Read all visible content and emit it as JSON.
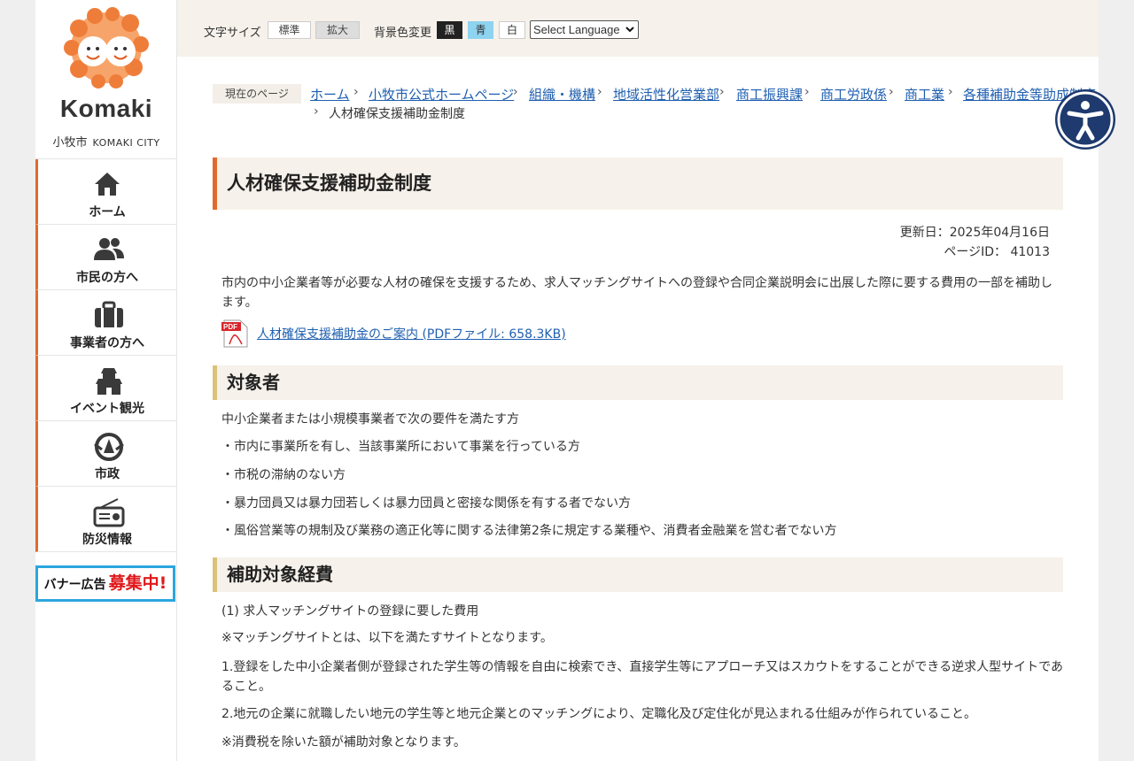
{
  "sidebar": {
    "logo_word": "Komaki",
    "city_name": "小牧市",
    "city_name_en": "KOMAKI CITY",
    "logo_icon": "komaki-faces-logo",
    "nav": [
      {
        "label": "ホーム",
        "icon": "home-icon"
      },
      {
        "label": "市民の方へ",
        "icon": "citizens-icon"
      },
      {
        "label": "事業者の方へ",
        "icon": "briefcase-icon"
      },
      {
        "label": "イベント観光",
        "icon": "castle-icon"
      },
      {
        "label": "市政",
        "icon": "city-emblem-icon"
      },
      {
        "label": "防災情報",
        "icon": "radio-icon"
      }
    ],
    "banner": {
      "text_a": "バナー広告",
      "text_b": "募集中!"
    }
  },
  "toolbar": {
    "font_size_label": "文字サイズ",
    "size_standard": "標準",
    "size_large": "拡大",
    "bg_label": "背景色変更",
    "bg_black": "黒",
    "bg_blue": "青",
    "bg_white": "白",
    "language": "Select Language"
  },
  "breadcrumb": {
    "tag": "現在のページ",
    "links": [
      "ホーム",
      "小牧市公式ホームページ",
      "組織・機構",
      "地域活性化営業部",
      "商工振興課",
      "商工労政係",
      "商工業",
      "各種補助金等助成制度"
    ],
    "current": "人材確保支援補助金制度"
  },
  "content": {
    "title": "人材確保支援補助金制度",
    "updated": "更新日：2025年04月16日",
    "page_id": "ページID： 41013",
    "intro": "市内の中小企業者等が必要な人材の確保を支援するため、求人マッチングサイトへの登録や合同企業説明会に出展した際に要する費用の一部を補助します。",
    "pdf_link": "人材確保支援補助金のご案内 (PDFファイル: 658.3KB)",
    "section1": {
      "heading": "対象者",
      "lines": [
        "中小企業者または小規模事業者で次の要件を満たす方",
        "・市内に事業所を有し、当該事業所において事業を行っている方",
        "・市税の滞納のない方",
        "・暴力団員又は暴力団若しくは暴力団員と密接な関係を有する者でない方",
        "・風俗営業等の規制及び業務の適正化等に関する法律第2条に規定する業種や、消費者金融業を営む者でない方"
      ]
    },
    "section2": {
      "heading": "補助対象経費",
      "lines": [
        "(1)  求人マッチングサイトの登録に要した費用",
        "※マッチングサイトとは、以下を満たすサイトとなります。",
        "1.登録をした中小企業者側が登録された学生等の情報を自由に検索でき、直接学生等にアプローチ又はスカウトをすることができる逆求人型サイトであること。",
        "2.地元の企業に就職したい地元の学生等と地元企業とのマッチングにより、定職化及び定住化が見込まれる仕組みが作られていること。",
        "※消費税を除いた額が補助対象となります。"
      ]
    }
  },
  "colors": {
    "accent": "#e06a2e",
    "link": "#1f5fb0",
    "section_bar": "#d9c27a",
    "band": "#f6f1ea"
  }
}
